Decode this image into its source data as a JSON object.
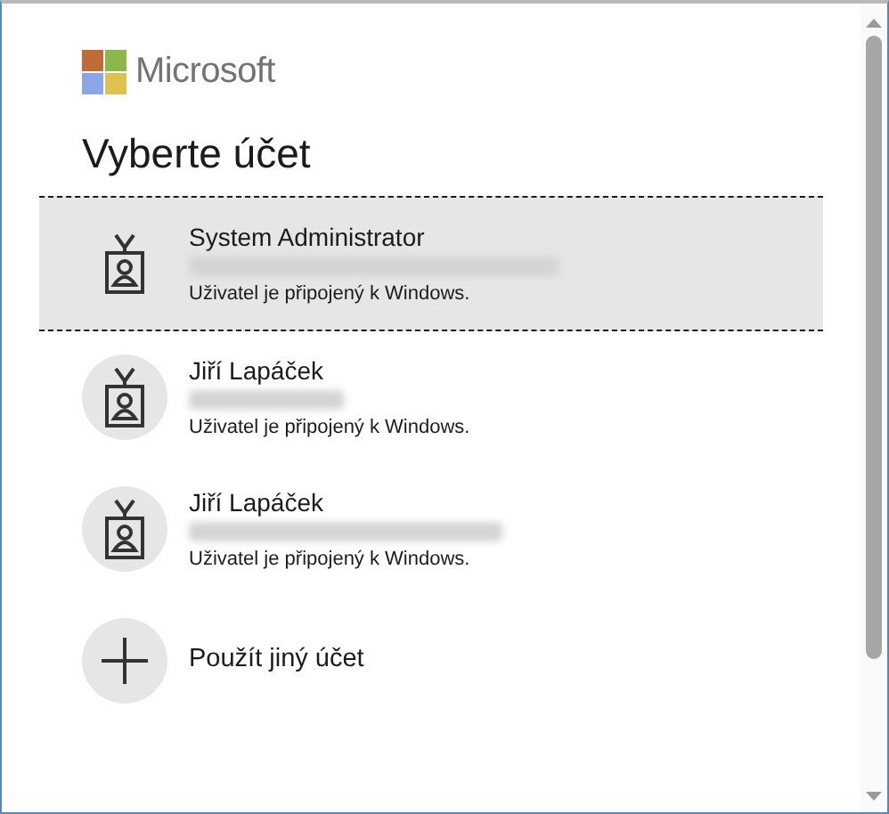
{
  "brand": {
    "name": "Microsoft"
  },
  "title": "Vyberte účet",
  "accounts": [
    {
      "kind": "account",
      "name": "System Administrator",
      "status": "Uživatel je připojený k Windows.",
      "selected": true
    },
    {
      "kind": "account",
      "name": "Jiří Lapáček",
      "status": "Uživatel je připojený k Windows.",
      "selected": false
    },
    {
      "kind": "account",
      "name": "Jiří Lapáček",
      "status": "Uživatel je připojený k Windows.",
      "selected": false
    },
    {
      "kind": "add",
      "name": "Použít jiný účet",
      "selected": false
    }
  ]
}
